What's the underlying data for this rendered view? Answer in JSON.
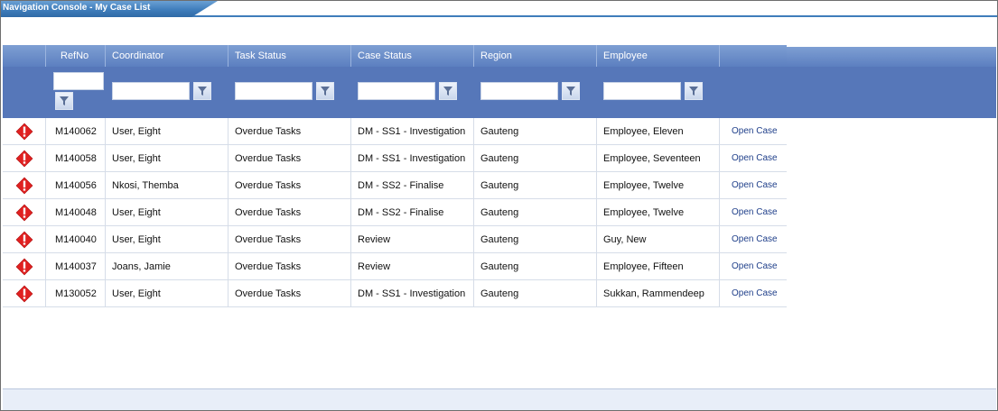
{
  "window": {
    "title": "Navigation Console - My Case List"
  },
  "columns": [
    "",
    "RefNo",
    "Coordinator",
    "Task Status",
    "Case Status",
    "Region",
    "Employee",
    ""
  ],
  "filter_icon": "funnel-icon",
  "warning_icon": "exclamation-icon",
  "colors": {
    "header": "#5c7fc0",
    "filter_bar": "#5677b9",
    "warning": "#e02020",
    "link": "#1f3f8a"
  },
  "rows": [
    {
      "ref": "M140062",
      "coordinator": "User, Eight",
      "task_status": "Overdue Tasks",
      "case_status": "DM - SS1 - Investigation",
      "region": "Gauteng",
      "employee": "Employee, Eleven",
      "action": "Open Case"
    },
    {
      "ref": "M140058",
      "coordinator": "User, Eight",
      "task_status": "Overdue Tasks",
      "case_status": "DM - SS1 - Investigation",
      "region": "Gauteng",
      "employee": "Employee, Seventeen",
      "action": "Open Case"
    },
    {
      "ref": "M140056",
      "coordinator": "Nkosi, Themba",
      "task_status": "Overdue Tasks",
      "case_status": "DM - SS2 - Finalise",
      "region": "Gauteng",
      "employee": "Employee, Twelve",
      "action": "Open Case"
    },
    {
      "ref": "M140048",
      "coordinator": "User, Eight",
      "task_status": "Overdue Tasks",
      "case_status": "DM - SS2 - Finalise",
      "region": "Gauteng",
      "employee": "Employee, Twelve",
      "action": "Open Case"
    },
    {
      "ref": "M140040",
      "coordinator": "User, Eight",
      "task_status": "Overdue Tasks",
      "case_status": "Review",
      "region": "Gauteng",
      "employee": "Guy, New",
      "action": "Open Case"
    },
    {
      "ref": "M140037",
      "coordinator": "Joans, Jamie",
      "task_status": "Overdue Tasks",
      "case_status": "Review",
      "region": "Gauteng",
      "employee": "Employee, Fifteen",
      "action": "Open Case"
    },
    {
      "ref": "M130052",
      "coordinator": "User, Eight",
      "task_status": "Overdue Tasks",
      "case_status": "DM - SS1 - Investigation",
      "region": "Gauteng",
      "employee": "Sukkan, Rammendeep",
      "action": "Open Case"
    }
  ]
}
